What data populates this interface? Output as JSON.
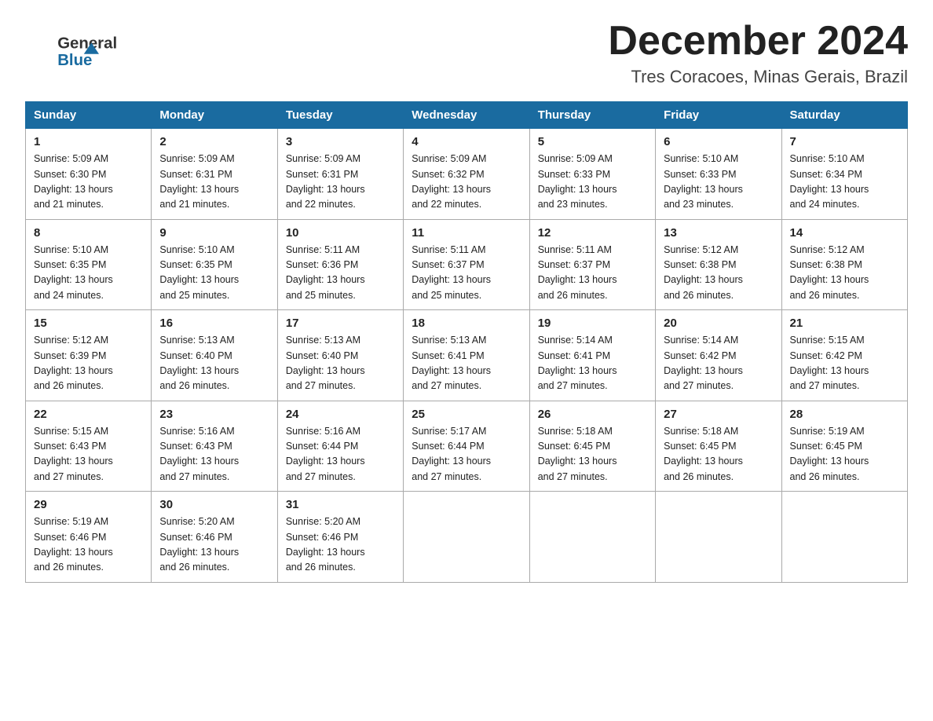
{
  "header": {
    "logo_general": "General",
    "logo_blue": "Blue",
    "month_title": "December 2024",
    "location": "Tres Coracoes, Minas Gerais, Brazil"
  },
  "weekdays": [
    "Sunday",
    "Monday",
    "Tuesday",
    "Wednesday",
    "Thursday",
    "Friday",
    "Saturday"
  ],
  "weeks": [
    [
      {
        "day": "1",
        "sunrise": "5:09 AM",
        "sunset": "6:30 PM",
        "daylight": "13 hours and 21 minutes."
      },
      {
        "day": "2",
        "sunrise": "5:09 AM",
        "sunset": "6:31 PM",
        "daylight": "13 hours and 21 minutes."
      },
      {
        "day": "3",
        "sunrise": "5:09 AM",
        "sunset": "6:31 PM",
        "daylight": "13 hours and 22 minutes."
      },
      {
        "day": "4",
        "sunrise": "5:09 AM",
        "sunset": "6:32 PM",
        "daylight": "13 hours and 22 minutes."
      },
      {
        "day": "5",
        "sunrise": "5:09 AM",
        "sunset": "6:33 PM",
        "daylight": "13 hours and 23 minutes."
      },
      {
        "day": "6",
        "sunrise": "5:10 AM",
        "sunset": "6:33 PM",
        "daylight": "13 hours and 23 minutes."
      },
      {
        "day": "7",
        "sunrise": "5:10 AM",
        "sunset": "6:34 PM",
        "daylight": "13 hours and 24 minutes."
      }
    ],
    [
      {
        "day": "8",
        "sunrise": "5:10 AM",
        "sunset": "6:35 PM",
        "daylight": "13 hours and 24 minutes."
      },
      {
        "day": "9",
        "sunrise": "5:10 AM",
        "sunset": "6:35 PM",
        "daylight": "13 hours and 25 minutes."
      },
      {
        "day": "10",
        "sunrise": "5:11 AM",
        "sunset": "6:36 PM",
        "daylight": "13 hours and 25 minutes."
      },
      {
        "day": "11",
        "sunrise": "5:11 AM",
        "sunset": "6:37 PM",
        "daylight": "13 hours and 25 minutes."
      },
      {
        "day": "12",
        "sunrise": "5:11 AM",
        "sunset": "6:37 PM",
        "daylight": "13 hours and 26 minutes."
      },
      {
        "day": "13",
        "sunrise": "5:12 AM",
        "sunset": "6:38 PM",
        "daylight": "13 hours and 26 minutes."
      },
      {
        "day": "14",
        "sunrise": "5:12 AM",
        "sunset": "6:38 PM",
        "daylight": "13 hours and 26 minutes."
      }
    ],
    [
      {
        "day": "15",
        "sunrise": "5:12 AM",
        "sunset": "6:39 PM",
        "daylight": "13 hours and 26 minutes."
      },
      {
        "day": "16",
        "sunrise": "5:13 AM",
        "sunset": "6:40 PM",
        "daylight": "13 hours and 26 minutes."
      },
      {
        "day": "17",
        "sunrise": "5:13 AM",
        "sunset": "6:40 PM",
        "daylight": "13 hours and 27 minutes."
      },
      {
        "day": "18",
        "sunrise": "5:13 AM",
        "sunset": "6:41 PM",
        "daylight": "13 hours and 27 minutes."
      },
      {
        "day": "19",
        "sunrise": "5:14 AM",
        "sunset": "6:41 PM",
        "daylight": "13 hours and 27 minutes."
      },
      {
        "day": "20",
        "sunrise": "5:14 AM",
        "sunset": "6:42 PM",
        "daylight": "13 hours and 27 minutes."
      },
      {
        "day": "21",
        "sunrise": "5:15 AM",
        "sunset": "6:42 PM",
        "daylight": "13 hours and 27 minutes."
      }
    ],
    [
      {
        "day": "22",
        "sunrise": "5:15 AM",
        "sunset": "6:43 PM",
        "daylight": "13 hours and 27 minutes."
      },
      {
        "day": "23",
        "sunrise": "5:16 AM",
        "sunset": "6:43 PM",
        "daylight": "13 hours and 27 minutes."
      },
      {
        "day": "24",
        "sunrise": "5:16 AM",
        "sunset": "6:44 PM",
        "daylight": "13 hours and 27 minutes."
      },
      {
        "day": "25",
        "sunrise": "5:17 AM",
        "sunset": "6:44 PM",
        "daylight": "13 hours and 27 minutes."
      },
      {
        "day": "26",
        "sunrise": "5:18 AM",
        "sunset": "6:45 PM",
        "daylight": "13 hours and 27 minutes."
      },
      {
        "day": "27",
        "sunrise": "5:18 AM",
        "sunset": "6:45 PM",
        "daylight": "13 hours and 26 minutes."
      },
      {
        "day": "28",
        "sunrise": "5:19 AM",
        "sunset": "6:45 PM",
        "daylight": "13 hours and 26 minutes."
      }
    ],
    [
      {
        "day": "29",
        "sunrise": "5:19 AM",
        "sunset": "6:46 PM",
        "daylight": "13 hours and 26 minutes."
      },
      {
        "day": "30",
        "sunrise": "5:20 AM",
        "sunset": "6:46 PM",
        "daylight": "13 hours and 26 minutes."
      },
      {
        "day": "31",
        "sunrise": "5:20 AM",
        "sunset": "6:46 PM",
        "daylight": "13 hours and 26 minutes."
      },
      null,
      null,
      null,
      null
    ]
  ],
  "labels": {
    "sunrise": "Sunrise:",
    "sunset": "Sunset:",
    "daylight": "Daylight:"
  },
  "colors": {
    "header_bg": "#1a6ba0",
    "header_text": "#ffffff",
    "border": "#aaaaaa",
    "text": "#222222"
  }
}
